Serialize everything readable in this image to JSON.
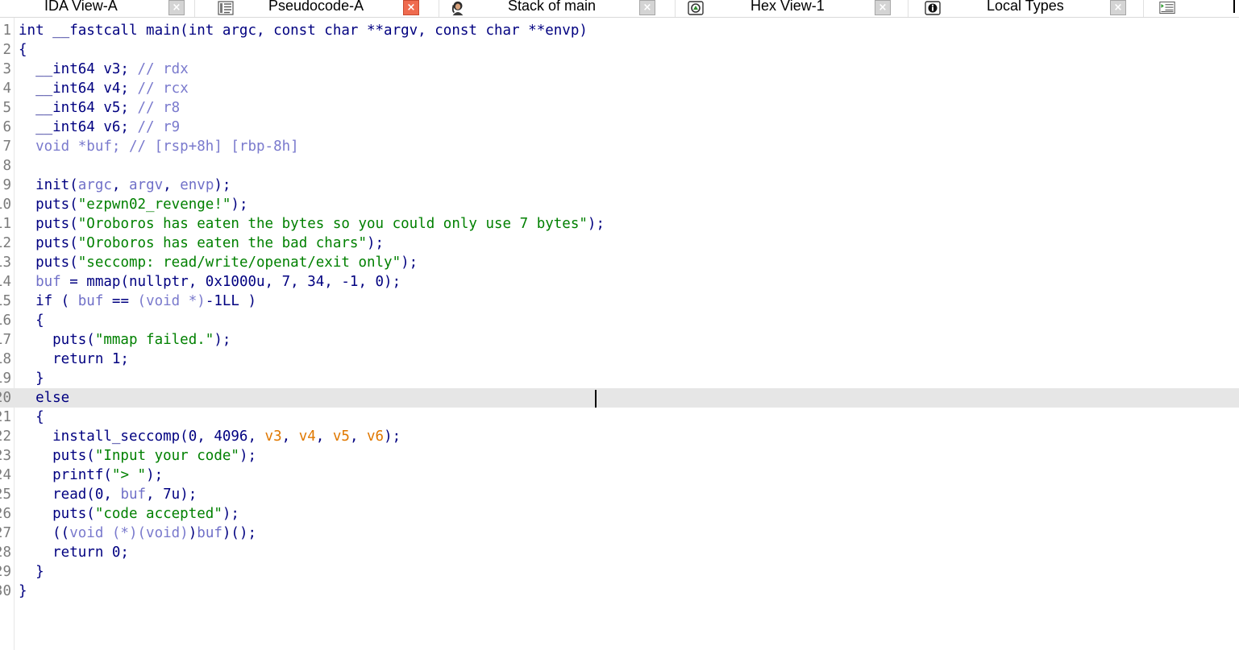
{
  "tabs": [
    {
      "label": "IDA View-A",
      "icon": "ida-view-icon",
      "active": false
    },
    {
      "label": "Pseudocode-A",
      "icon": "pseudocode-icon",
      "active": true
    },
    {
      "label": "Stack of main",
      "icon": "stack-icon",
      "active": false
    },
    {
      "label": "Hex View-1",
      "icon": "hex-view-icon",
      "active": false
    },
    {
      "label": "Local Types",
      "icon": "local-types-icon",
      "active": false
    }
  ],
  "close_glyph": "×",
  "colors": {
    "keyword": "#000080",
    "comment": "#7a7acd",
    "string": "#008000",
    "variable": "#7070c8",
    "register_arg": "#e07800",
    "active_close": "#ef6b4f",
    "highlight_line": "#e6e6e6"
  },
  "cursor_line": 20,
  "code": [
    {
      "n": "1",
      "t": [
        [
          "int __fastcall main(int argc, const char **argv, const char **envp)",
          "k"
        ]
      ]
    },
    {
      "n": "2",
      "t": [
        [
          "{",
          "k"
        ]
      ]
    },
    {
      "n": "3",
      "t": [
        [
          "  __int64 v3; ",
          "k"
        ],
        [
          "// rdx",
          "c"
        ]
      ]
    },
    {
      "n": "4",
      "t": [
        [
          "  __int64 v4; ",
          "k"
        ],
        [
          "// rcx",
          "c"
        ]
      ]
    },
    {
      "n": "5",
      "t": [
        [
          "  __int64 v5; ",
          "k"
        ],
        [
          "// r8",
          "c"
        ]
      ]
    },
    {
      "n": "6",
      "t": [
        [
          "  __int64 v6; ",
          "k"
        ],
        [
          "// r9",
          "c"
        ]
      ]
    },
    {
      "n": "7",
      "t": [
        [
          "  void *buf; ",
          "c"
        ],
        [
          "// [rsp+8h] [rbp-8h]",
          "c"
        ]
      ]
    },
    {
      "n": "8",
      "t": [
        [
          "",
          "k"
        ]
      ]
    },
    {
      "n": "9",
      "t": [
        [
          "  init(",
          "k"
        ],
        [
          "argc",
          "v"
        ],
        [
          ", ",
          "k"
        ],
        [
          "argv",
          "v"
        ],
        [
          ", ",
          "k"
        ],
        [
          "envp",
          "v"
        ],
        [
          ");",
          "k"
        ]
      ]
    },
    {
      "n": "10",
      "t": [
        [
          "  puts(",
          "k"
        ],
        [
          "\"ezpwn02_revenge!\"",
          "s"
        ],
        [
          ");",
          "k"
        ]
      ]
    },
    {
      "n": "11",
      "t": [
        [
          "  puts(",
          "k"
        ],
        [
          "\"Oroboros has eaten the bytes so you could only use 7 bytes\"",
          "s"
        ],
        [
          ");",
          "k"
        ]
      ]
    },
    {
      "n": "12",
      "t": [
        [
          "  puts(",
          "k"
        ],
        [
          "\"Oroboros has eaten the bad chars\"",
          "s"
        ],
        [
          ");",
          "k"
        ]
      ]
    },
    {
      "n": "13",
      "t": [
        [
          "  puts(",
          "k"
        ],
        [
          "\"seccomp: read/write/openat/exit only\"",
          "s"
        ],
        [
          ");",
          "k"
        ]
      ]
    },
    {
      "n": "14",
      "t": [
        [
          "  ",
          "k"
        ],
        [
          "buf",
          "v"
        ],
        [
          " = mmap(nullptr, 0x1000u, 7, 34, -1, 0);",
          "k"
        ]
      ]
    },
    {
      "n": "15",
      "t": [
        [
          "  if ( ",
          "k"
        ],
        [
          "buf",
          "v"
        ],
        [
          " == ",
          "k"
        ],
        [
          "(void *)",
          "c"
        ],
        [
          "-1LL )",
          "k"
        ]
      ]
    },
    {
      "n": "16",
      "t": [
        [
          "  {",
          "k"
        ]
      ]
    },
    {
      "n": "17",
      "t": [
        [
          "    puts(",
          "k"
        ],
        [
          "\"mmap failed.\"",
          "s"
        ],
        [
          ");",
          "k"
        ]
      ]
    },
    {
      "n": "18",
      "t": [
        [
          "    return 1;",
          "k"
        ]
      ]
    },
    {
      "n": "19",
      "t": [
        [
          "  }",
          "k"
        ]
      ]
    },
    {
      "n": "20",
      "t": [
        [
          "  else",
          "k"
        ]
      ]
    },
    {
      "n": "21",
      "t": [
        [
          "  {",
          "k"
        ]
      ]
    },
    {
      "n": "22",
      "t": [
        [
          "    install_seccomp(0, 4096, ",
          "k"
        ],
        [
          "v3",
          "o"
        ],
        [
          ", ",
          "k"
        ],
        [
          "v4",
          "o"
        ],
        [
          ", ",
          "k"
        ],
        [
          "v5",
          "o"
        ],
        [
          ", ",
          "k"
        ],
        [
          "v6",
          "o"
        ],
        [
          ");",
          "k"
        ]
      ]
    },
    {
      "n": "23",
      "t": [
        [
          "    puts(",
          "k"
        ],
        [
          "\"Input your code\"",
          "s"
        ],
        [
          ");",
          "k"
        ]
      ]
    },
    {
      "n": "24",
      "t": [
        [
          "    printf(",
          "k"
        ],
        [
          "\"> \"",
          "s"
        ],
        [
          ");",
          "k"
        ]
      ]
    },
    {
      "n": "25",
      "t": [
        [
          "    read(0, ",
          "k"
        ],
        [
          "buf",
          "v"
        ],
        [
          ", 7u);",
          "k"
        ]
      ]
    },
    {
      "n": "26",
      "t": [
        [
          "    puts(",
          "k"
        ],
        [
          "\"code accepted\"",
          "s"
        ],
        [
          ");",
          "k"
        ]
      ]
    },
    {
      "n": "27",
      "t": [
        [
          "    ((",
          "k"
        ],
        [
          "void (*)(void)",
          "c"
        ],
        [
          ")",
          "k"
        ],
        [
          "buf",
          "v"
        ],
        [
          ")();",
          "k"
        ]
      ]
    },
    {
      "n": "28",
      "t": [
        [
          "    return 0;",
          "k"
        ]
      ]
    },
    {
      "n": "29",
      "t": [
        [
          "  }",
          "k"
        ]
      ]
    },
    {
      "n": "30",
      "t": [
        [
          "}",
          "k"
        ]
      ]
    }
  ]
}
